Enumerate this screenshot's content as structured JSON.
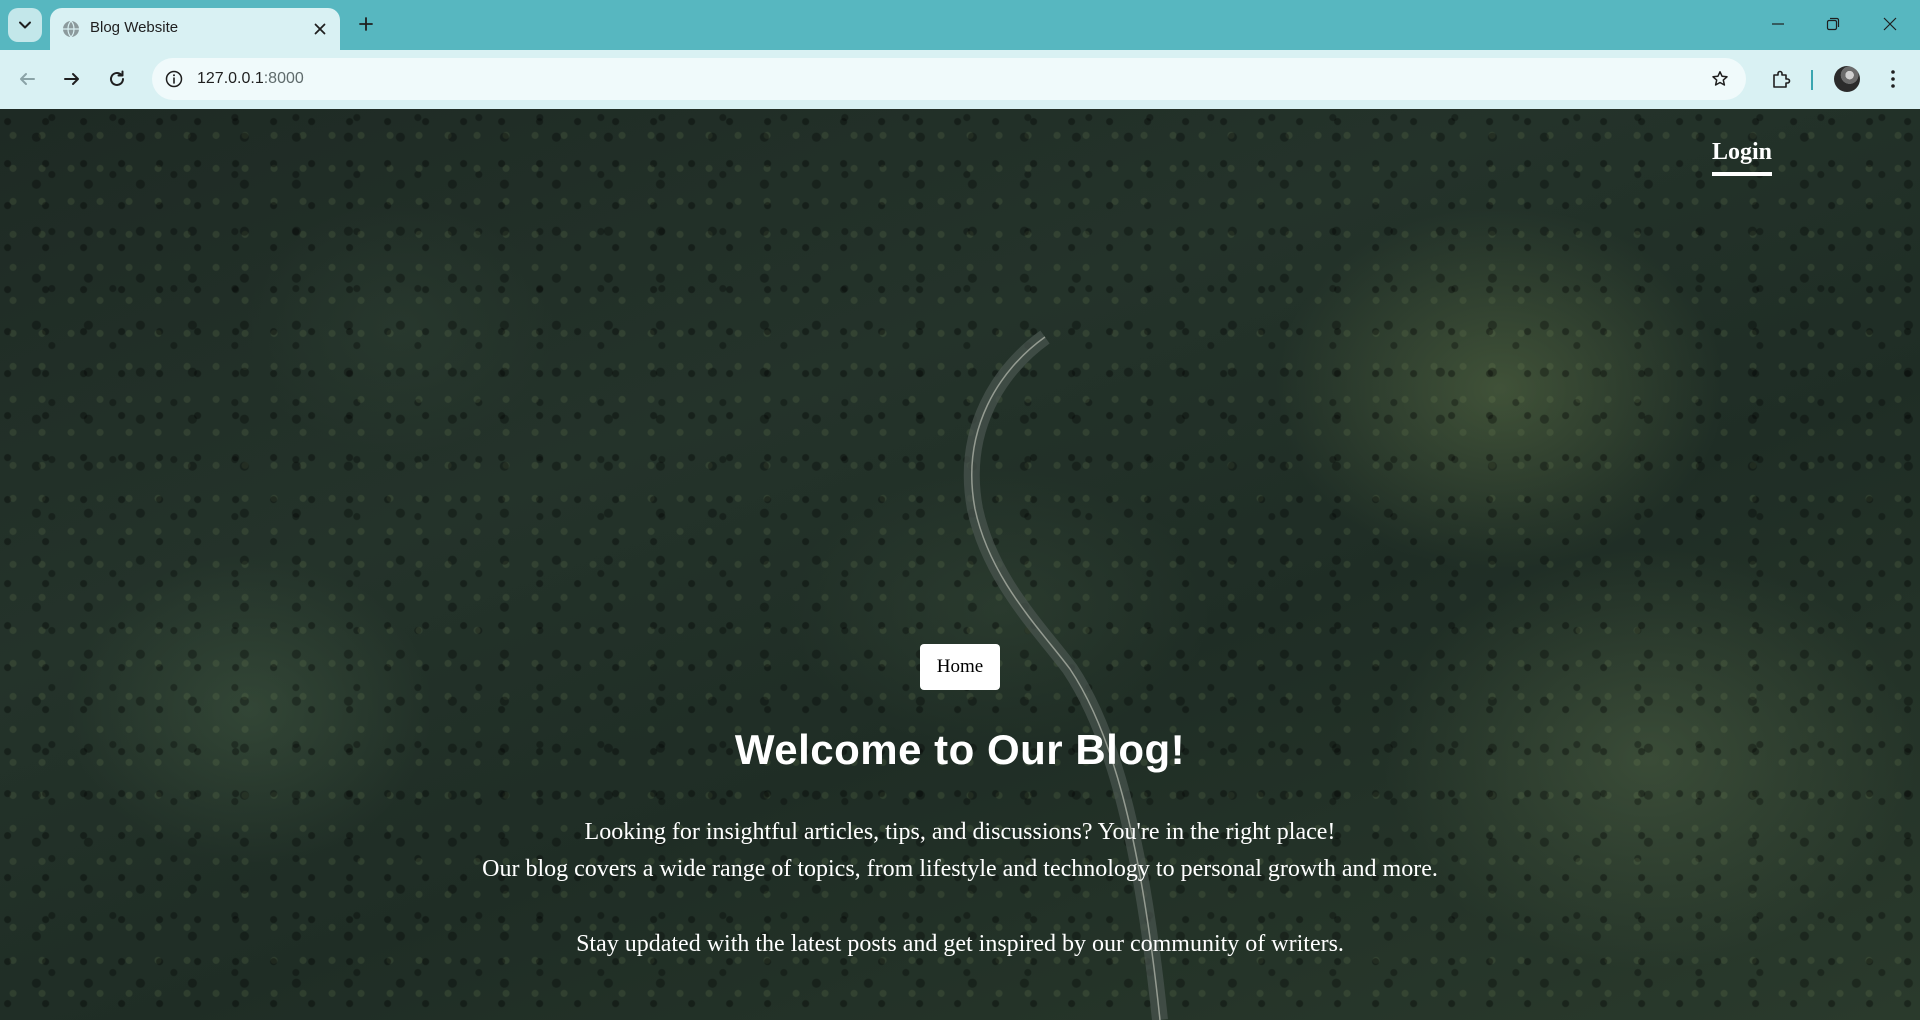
{
  "browser": {
    "tab": {
      "title": "Blog Website"
    },
    "address_bar": {
      "url_host": "127.0.0.1",
      "url_port": ":8000"
    },
    "icons": {
      "tab_search": "chevron-down-icon",
      "favicon": "globe-icon",
      "tab_close": "close-icon",
      "new_tab": "plus-icon",
      "minimize": "minimize-icon",
      "restore": "restore-icon",
      "close_window": "close-icon",
      "back": "arrow-left-icon",
      "forward": "arrow-right-icon",
      "reload": "reload-icon",
      "site_info": "info-icon",
      "bookmark": "star-icon",
      "extensions": "puzzle-icon",
      "menu": "kebab-menu-icon"
    },
    "colors": {
      "frame": "#57b7c0",
      "toolbar": "#d9f1f3",
      "omnibox": "#f0fafb"
    }
  },
  "page": {
    "nav": {
      "login_label": "Login"
    },
    "home_button_label": "Home",
    "title": "Welcome to Our Blog!",
    "lines": [
      "Looking for insightful articles, tips, and discussions? You're in the right place!",
      "Our blog covers a wide range of topics, from lifestyle and technology to personal growth and more.",
      "Stay updated with the latest posts and get inspired by our community of writers."
    ]
  }
}
